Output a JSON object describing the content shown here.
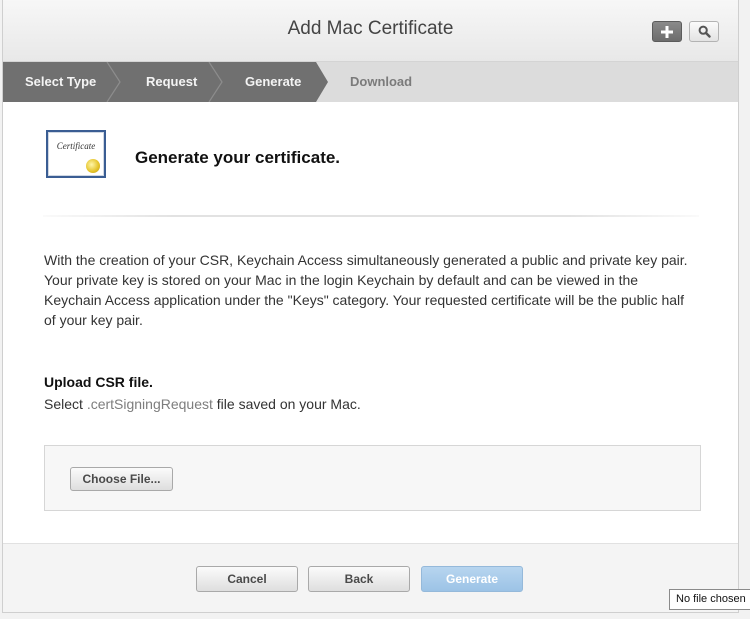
{
  "header": {
    "title": "Add Mac Certificate",
    "add_icon": "plus-icon",
    "search_icon": "magnifier-icon"
  },
  "steps": [
    {
      "label": "Select Type",
      "state": "done"
    },
    {
      "label": "Request",
      "state": "done"
    },
    {
      "label": "Generate",
      "state": "current"
    },
    {
      "label": "Download",
      "state": "todo"
    }
  ],
  "main": {
    "cert_icon_text": "Certificate",
    "title": "Generate your certificate.",
    "description": "With the creation of your CSR, Keychain Access simultaneously generated a public and private key pair. Your private key is stored on your Mac in the login Keychain by default and can be viewed in the Keychain Access application under the \"Keys\" category. Your requested certificate will be the public half of your key pair.",
    "upload_label": "Upload CSR file.",
    "upload_help_prefix": "Select ",
    "upload_help_ext": ".certSigningRequest",
    "upload_help_suffix": " file saved on your Mac.",
    "choose_file_label": "Choose File..."
  },
  "footer": {
    "cancel_label": "Cancel",
    "back_label": "Back",
    "generate_label": "Generate"
  },
  "tooltip": {
    "no_file_text": "No file chosen"
  },
  "colors": {
    "steps_done": "#6f6f6f",
    "steps_todo": "#dcdcdc",
    "generate_disabled": "#a9cbea",
    "cert_border": "#3a5d93"
  }
}
